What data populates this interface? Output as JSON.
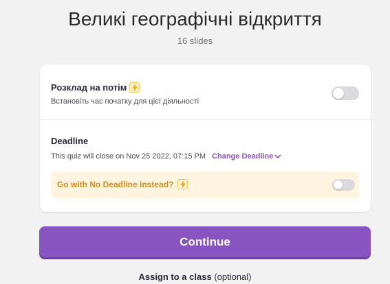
{
  "header": {
    "title": "Великі географічні відкриття",
    "slides": "16 slides"
  },
  "schedule": {
    "title": "Розклад на потім",
    "description": "Встановіть час початку для цієї діяльності",
    "toggle_on": false
  },
  "deadline": {
    "title": "Deadline",
    "info": "This quiz will close on Nov 25 2022, 07:15 PM",
    "change_label": "Change Deadline",
    "no_deadline_label": "Go with No Deadline instead?",
    "no_deadline_toggle_on": false
  },
  "continue_label": "Continue",
  "assign": {
    "label": "Assign to a class",
    "optional": "(optional)"
  },
  "colors": {
    "accent": "#8854c0",
    "warning_text": "#d98b16",
    "warning_bg": "#fff4e0",
    "bolt_bg": "#fff4cf",
    "bolt_border": "#f5c345"
  },
  "icons": {
    "bolt": "lightning-bolt-icon",
    "chevron": "chevron-down-icon"
  }
}
